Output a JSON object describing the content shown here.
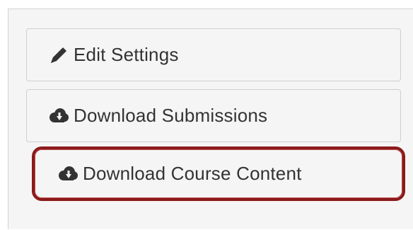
{
  "buttons": [
    {
      "label": "Edit Settings",
      "icon": "pencil-icon"
    },
    {
      "label": "Download Submissions",
      "icon": "cloud-download-icon"
    },
    {
      "label": "Download Course Content",
      "icon": "cloud-download-icon",
      "highlight_color": "#8b1a1a"
    }
  ]
}
